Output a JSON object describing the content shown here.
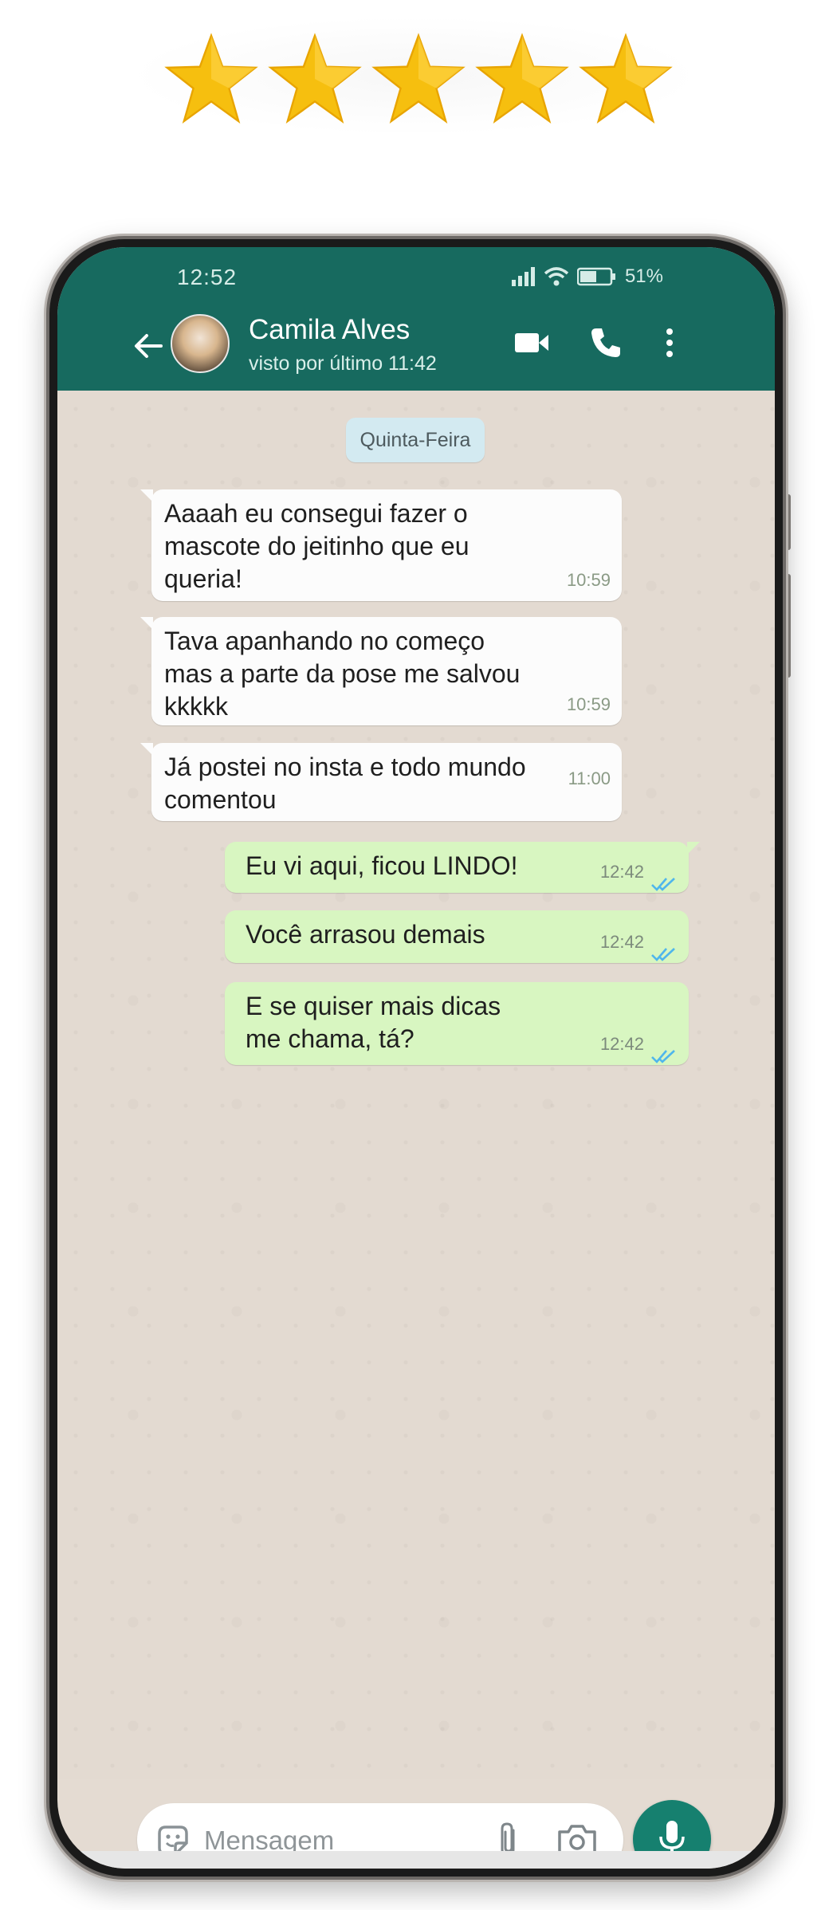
{
  "rating": {
    "stars": 5,
    "star_color": "#f6bf0f"
  },
  "status_bar": {
    "time": "12:52",
    "battery": "51%"
  },
  "header": {
    "contact_name": "Camila Alves",
    "last_seen": "visto por último 11:42",
    "icons": [
      "back-arrow-icon",
      "video-call-icon",
      "phone-call-icon",
      "more-options-icon"
    ]
  },
  "chat": {
    "date_chip": "Quinta-Feira",
    "messages": [
      {
        "direction": "in",
        "text": "Aaaah eu consegui fazer o\nmascote do jeitinho que eu\nqueria!",
        "time": "10:59"
      },
      {
        "direction": "in",
        "text": "Tava apanhando no começo\nmas a parte da pose me salvou\nkkkkk",
        "time": "10:59"
      },
      {
        "direction": "in",
        "text": "Já postei no insta e todo mundo\ncomentou",
        "time": "11:00"
      },
      {
        "direction": "out",
        "text": "Eu vi aqui, ficou LINDO!",
        "time": "12:42",
        "status": "read"
      },
      {
        "direction": "out",
        "text": "Você arrasou demais",
        "time": "12:42",
        "status": "read"
      },
      {
        "direction": "out",
        "text": "E se quiser mais dicas\nme chama, tá?",
        "time": "12:42",
        "status": "read"
      }
    ]
  },
  "composer": {
    "placeholder": "Mensagem",
    "value": ""
  },
  "colors": {
    "header": "#176a5f",
    "incoming_bubble": "#fcfcfc",
    "outgoing_bubble": "#d8f6c1",
    "read_ticks": "#4fb6ec",
    "mic_button": "#16806f"
  }
}
